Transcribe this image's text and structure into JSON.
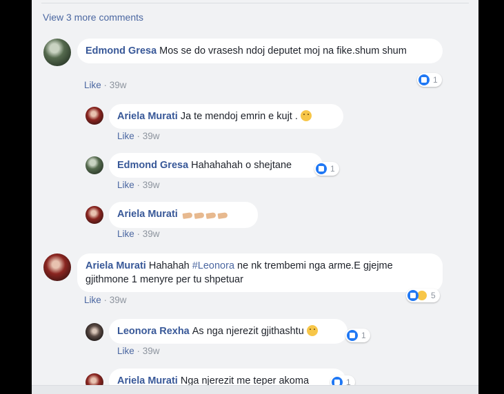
{
  "view_more": "View 3 more comments",
  "comments": [
    {
      "name": "Edmond Gresa",
      "text": "Mos se do vrasesh ndoj deputet moj na fike.shum shum",
      "like": "Like",
      "time": "39w",
      "reaction_count": "1"
    },
    {
      "name": "Ariela Murati",
      "text": "Ja te mendoj emrin e kujt .",
      "like": "Like",
      "time": "39w"
    },
    {
      "name": "Edmond Gresa",
      "text": "Hahahahah o shejtane",
      "like": "Like",
      "time": "39w",
      "reaction_count": "1"
    },
    {
      "name": "Ariela Murati",
      "like": "Like",
      "time": "39w"
    },
    {
      "name": "Ariela Murati",
      "text_before": "Hahahah ",
      "tag": "#Leonora",
      "text_after": " ne nk trembemi nga arme.E gjejme gjithmone 1 menyre per tu shpetuar",
      "like": "Like",
      "time": "39w",
      "reaction_count": "5"
    },
    {
      "name": "Leonora Rexha",
      "text": "As nga njerezit gjithashtu",
      "like": "Like",
      "time": "39w",
      "reaction_count": "1"
    },
    {
      "name": "Ariela Murati",
      "text": "Nga njerezit me teper akoma",
      "reaction_count": "1"
    }
  ],
  "meta_separator": " · ",
  "colors": {
    "link": "#385898",
    "like_blue": "#2078f4",
    "panel_bg": "#f1f2f4"
  }
}
